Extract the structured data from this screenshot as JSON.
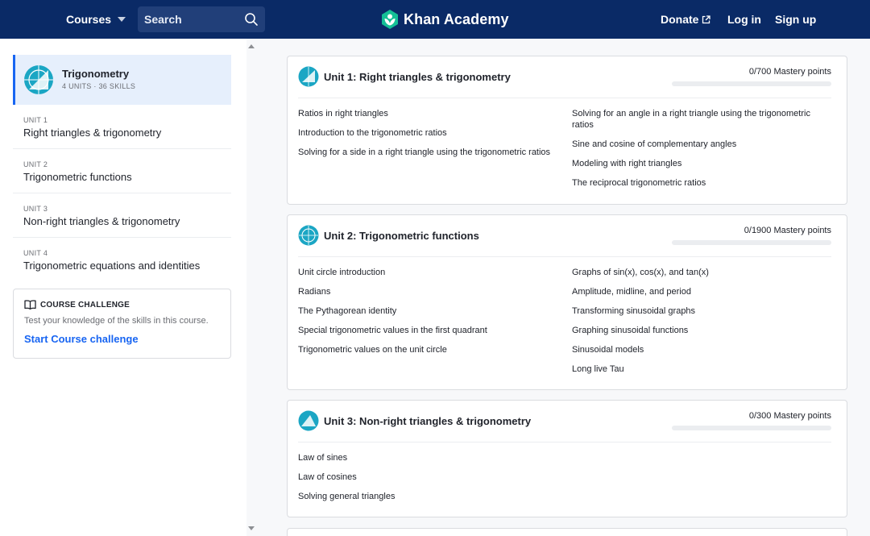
{
  "header": {
    "courses_label": "Courses",
    "search_placeholder": "Search",
    "logo_text": "Khan Academy",
    "donate_label": "Donate",
    "login_label": "Log in",
    "signup_label": "Sign up",
    "colors": {
      "bar": "#0a2a66",
      "search_bg": "#213f79",
      "logo_green": "#14bf96"
    }
  },
  "sidebar": {
    "course_title": "Trigonometry",
    "course_meta": "4 UNITS · 36 SKILLS",
    "units": [
      {
        "kicker": "UNIT 1",
        "title": "Right triangles & trigonometry"
      },
      {
        "kicker": "UNIT 2",
        "title": "Trigonometric functions"
      },
      {
        "kicker": "UNIT 3",
        "title": "Non-right triangles & trigonometry"
      },
      {
        "kicker": "UNIT 4",
        "title": "Trigonometric equations and identities"
      }
    ],
    "challenge": {
      "heading": "COURSE CHALLENGE",
      "description": "Test your knowledge of the skills in this course.",
      "link": "Start Course challenge"
    }
  },
  "units": [
    {
      "title": "Unit 1: Right triangles & trigonometry",
      "mastery": "0/700 Mastery points",
      "progress": 0,
      "left": [
        "Ratios in right triangles",
        "Introduction to the trigonometric ratios",
        "Solving for a side in a right triangle using the trigonometric ratios"
      ],
      "right": [
        "Solving for an angle in a right triangle using the trigonometric ratios",
        "Sine and cosine of complementary angles",
        "Modeling with right triangles",
        "The reciprocal trigonometric ratios"
      ]
    },
    {
      "title": "Unit 2: Trigonometric functions",
      "mastery": "0/1900 Mastery points",
      "progress": 0,
      "left": [
        "Unit circle introduction",
        "Radians",
        "The Pythagorean identity",
        "Special trigonometric values in the first quadrant",
        "Trigonometric values on the unit circle"
      ],
      "right": [
        "Graphs of sin(x), cos(x), and tan(x)",
        "Amplitude, midline, and period",
        "Transforming sinusoidal graphs",
        "Graphing sinusoidal functions",
        "Sinusoidal models",
        "Long live Tau"
      ]
    },
    {
      "title": "Unit 3: Non-right triangles & trigonometry",
      "mastery": "0/300 Mastery points",
      "progress": 0,
      "left": [
        "Law of sines",
        "Law of cosines",
        "Solving general triangles"
      ],
      "right": []
    }
  ]
}
